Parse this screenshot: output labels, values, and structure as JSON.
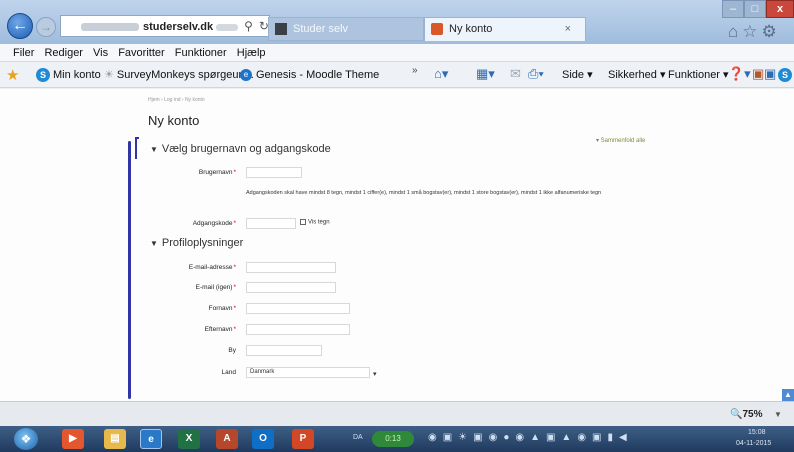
{
  "browser": {
    "address_text": "studerselv.dk",
    "tabs": [
      {
        "label": "Studer selv"
      },
      {
        "label": "Ny konto",
        "close": "×"
      }
    ],
    "window_controls": {
      "minimize": "–",
      "maximize": "□",
      "close": "x"
    },
    "top_icons": "⌂☆⚙",
    "menu": [
      "Filer",
      "Rediger",
      "Vis",
      "Favoritter",
      "Funktioner",
      "Hjælp"
    ],
    "favorites": [
      {
        "label": "Min konto"
      },
      {
        "label": "SurveyMonkeys spørgeun..."
      },
      {
        "label": "Genesis - Moodle Theme"
      }
    ],
    "command_bar": {
      "side": "Side ▾",
      "security": "Sikkerhed ▾",
      "tools": "Funktioner ▾"
    },
    "zoom": "75%"
  },
  "page": {
    "breadcrumb": "Hjem  ›  Log ind  ›  Ny konto",
    "title": "Ny konto",
    "collapse_link": "▾ Sammenfold alle",
    "section1": "Vælg brugernavn og adgangskode",
    "section2": "Profiloplysninger",
    "fields": {
      "username": "Brugernavn",
      "password": "Adgangskode",
      "show_password": "Vis tegn",
      "email": "E-mail-adresse",
      "email_again": "E-mail (igen)",
      "firstname": "Fornavn",
      "lastname": "Efternavn",
      "city": "By",
      "country": "Land",
      "country_value": "Danmark"
    },
    "password_help": "Adgangskoden skal have mindst 8 tegn, mindst 1 ciffer(e), mindst 1 små bogstav(er), mindst 1 store bogstav(er), mindst 1 ikke alfanumeriske tegn"
  },
  "taskbar": {
    "lang": "DA",
    "pill": "0:13",
    "time": "15:08",
    "date": "04-11-2015"
  }
}
